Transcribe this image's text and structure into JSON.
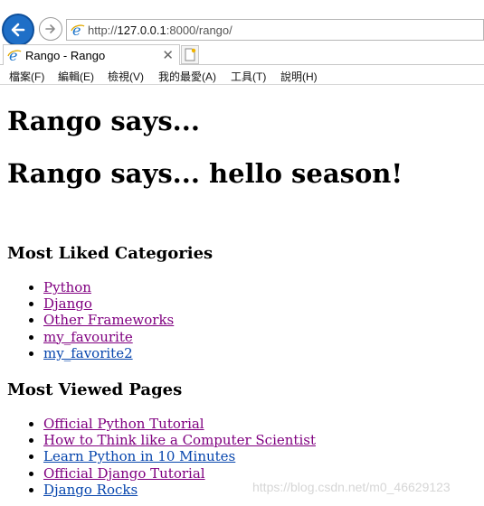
{
  "browser": {
    "url_prefix": "http://",
    "url_host": "127.0.0.1",
    "url_rest": ":8000/rango/",
    "tab_title": "Rango - Rango",
    "tab_close": "✕",
    "menu": [
      "檔案(F)",
      "編輯(E)",
      "檢視(V)",
      "我的最愛(A)",
      "工具(T)",
      "說明(H)"
    ]
  },
  "page": {
    "heading1": "Rango says...",
    "heading2": "Rango says... hello season!",
    "categories_title": "Most Liked Categories",
    "categories": [
      "Python",
      "Django",
      "Other Frameworks",
      "my_favourite",
      "my_favorite2"
    ],
    "pages_title": "Most Viewed Pages",
    "pages": [
      "Official Python Tutorial",
      "How to Think like a Computer Scientist",
      "Learn Python in 10 Minutes",
      "Official Django Tutorial",
      "Django Rocks"
    ]
  },
  "watermark": "https://blog.csdn.net/m0_46629123",
  "colors": {
    "visited_link": "#800080",
    "unvisited_link": "#0645ad",
    "back_button": "#1f6fc7"
  }
}
